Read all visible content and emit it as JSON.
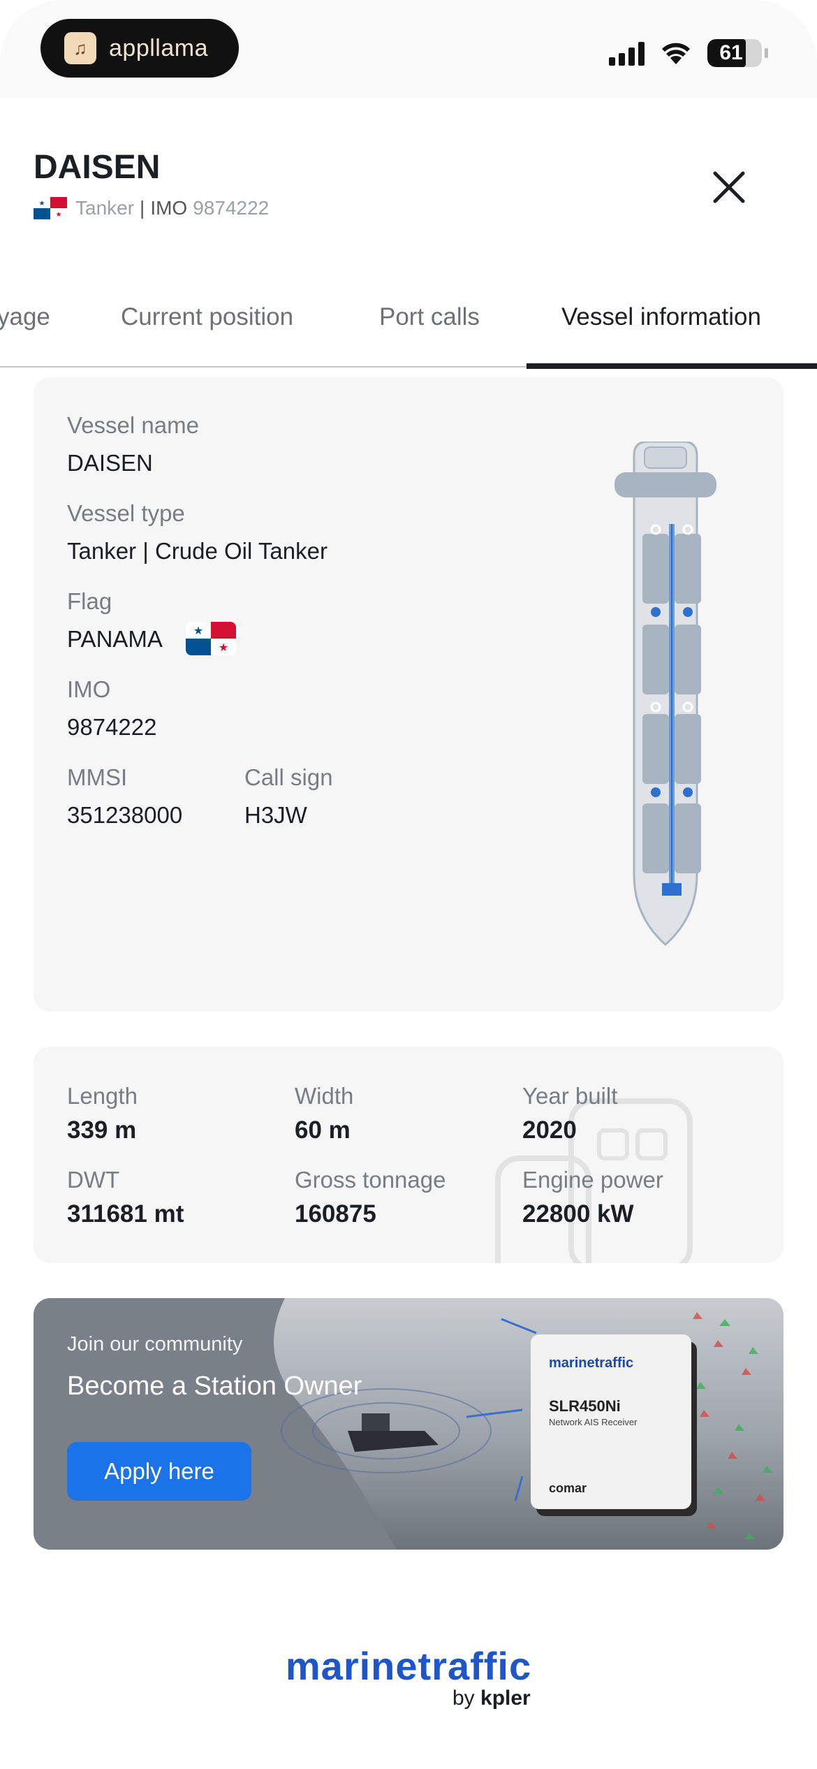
{
  "status_bar": {
    "pill_brand": "appllama",
    "battery": "61"
  },
  "header": {
    "vessel_name": "DAISEN",
    "vessel_type": "Tanker",
    "imo_label": "IMO",
    "imo_value": "9874222"
  },
  "tabs": [
    {
      "label": "yage"
    },
    {
      "label": "Current position"
    },
    {
      "label": "Port calls"
    },
    {
      "label": "Vessel information",
      "active": true
    }
  ],
  "vessel_info": {
    "name_label": "Vessel name",
    "name_value": "DAISEN",
    "type_label": "Vessel type",
    "type_value": "Tanker | Crude Oil Tanker",
    "flag_label": "Flag",
    "flag_value": "PANAMA",
    "imo_label": "IMO",
    "imo_value": "9874222",
    "mmsi_label": "MMSI",
    "mmsi_value": "351238000",
    "callsign_label": "Call sign",
    "callsign_value": "H3JW"
  },
  "dimensions": {
    "length_label": "Length",
    "length_value": "339 m",
    "width_label": "Width",
    "width_value": "60 m",
    "year_label": "Year built",
    "year_value": "2020",
    "dwt_label": "DWT",
    "dwt_value": "311681 mt",
    "gross_label": "Gross tonnage",
    "gross_value": "160875",
    "engine_label": "Engine power",
    "engine_value": "22800 kW"
  },
  "banner": {
    "join": "Join our community",
    "headline": "Become a Station Owner",
    "button": "Apply here",
    "device_brand": "marinetraffic",
    "device_model": "SLR450Ni",
    "device_desc": "Network AIS Receiver",
    "device_maker": "comar"
  },
  "footer": {
    "logo": "marinetraffic",
    "by": "by",
    "company": "kpler"
  },
  "colors": {
    "accent": "#1a73e8",
    "brand_blue": "#1e55c8",
    "card_bg": "#f6f6f6"
  }
}
